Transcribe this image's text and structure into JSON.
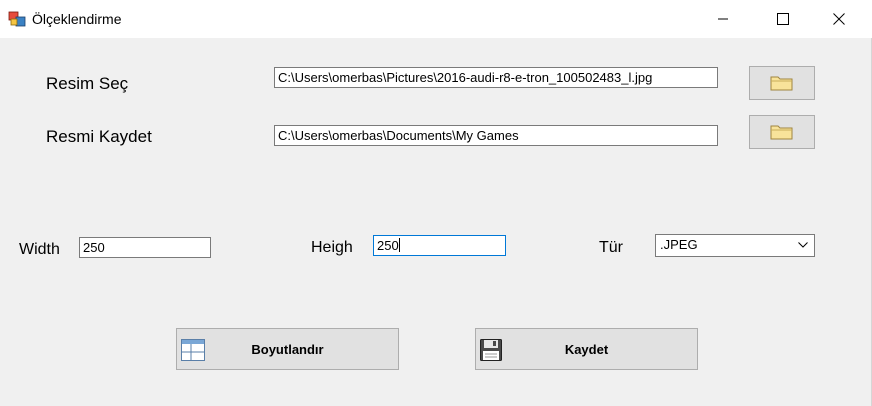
{
  "window": {
    "title": "Ölçeklendirme"
  },
  "form": {
    "resim_sec_label": "Resim Seç",
    "resim_sec_path": "C:\\Users\\omerbas\\Pictures\\2016-audi-r8-e-tron_100502483_l.jpg",
    "resmi_kaydet_label": "Resmi Kaydet",
    "resmi_kaydet_path": "C:\\Users\\omerbas\\Documents\\My Games",
    "width_label": "Width",
    "width_value": "250",
    "heigh_label": "Heigh",
    "heigh_value": "250",
    "tur_label": "Tür",
    "tur_value": ".JPEG"
  },
  "buttons": {
    "boyutlandir": "Boyutlandır",
    "kaydet": "Kaydet"
  },
  "icons": {
    "app": "app-icon",
    "browse": "folder-icon",
    "resize": "window-layout-icon",
    "save": "floppy-disk-icon"
  },
  "colors": {
    "focus_border": "#0078d7",
    "background": "#f0f0f0"
  }
}
